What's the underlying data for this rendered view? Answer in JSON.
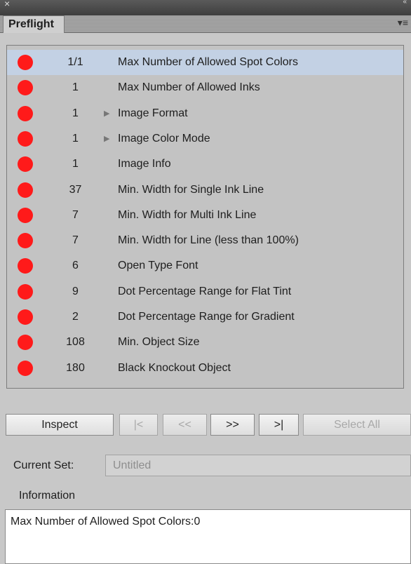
{
  "panel": {
    "close_glyph": "×",
    "collapse_glyph": "«",
    "tab_title": "Preflight",
    "menu_glyph": "▾≡"
  },
  "rows": [
    {
      "count": "1/1",
      "label": "Max Number of  Allowed Spot Colors",
      "expandable": false,
      "selected": true
    },
    {
      "count": "1",
      "label": "Max Number of  Allowed Inks",
      "expandable": false,
      "selected": false
    },
    {
      "count": "1",
      "label": "Image Format",
      "expandable": true,
      "selected": false
    },
    {
      "count": "1",
      "label": "Image Color Mode",
      "expandable": true,
      "selected": false
    },
    {
      "count": "1",
      "label": "Image Info",
      "expandable": false,
      "selected": false
    },
    {
      "count": "37",
      "label": "Min. Width for Single Ink Line",
      "expandable": false,
      "selected": false
    },
    {
      "count": "7",
      "label": "Min. Width for Multi Ink Line",
      "expandable": false,
      "selected": false
    },
    {
      "count": "7",
      "label": "Min. Width for Line (less than 100%)",
      "expandable": false,
      "selected": false
    },
    {
      "count": "6",
      "label": "Open Type Font",
      "expandable": false,
      "selected": false
    },
    {
      "count": "9",
      "label": "Dot Percentage Range for Flat Tint",
      "expandable": false,
      "selected": false
    },
    {
      "count": "2",
      "label": "Dot Percentage Range for Gradient",
      "expandable": false,
      "selected": false
    },
    {
      "count": "108",
      "label": "Min. Object Size",
      "expandable": false,
      "selected": false
    },
    {
      "count": "180",
      "label": "Black Knockout Object",
      "expandable": false,
      "selected": false
    }
  ],
  "status_color": "#ff1a1a",
  "expand_glyph": "▶",
  "buttons": {
    "inspect": "Inspect",
    "first": "|<",
    "prev": "<<",
    "next": ">>",
    "last": ">|",
    "select_all": "Select All"
  },
  "current_set": {
    "label": "Current Set:",
    "value": "Untitled"
  },
  "information": {
    "label": "Information",
    "text": "Max Number of  Allowed Spot Colors:0"
  }
}
